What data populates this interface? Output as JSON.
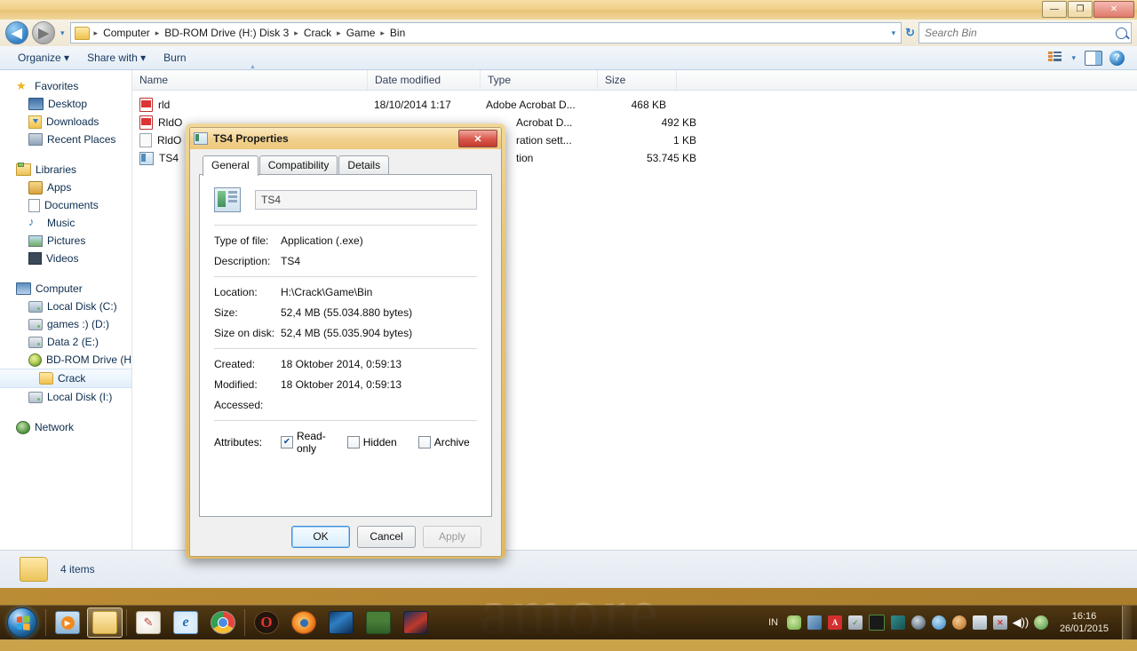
{
  "window": {
    "title": "",
    "minimize_label": "—",
    "maximize_label": "❐",
    "close_label": "✕"
  },
  "address": {
    "back_label": "◀",
    "forward_label": "▶",
    "history_caret": "▾",
    "breadcrumbs": [
      "Computer",
      "BD-ROM Drive (H:) Disk 3",
      "Crack",
      "Game",
      "Bin"
    ],
    "separator": "▸",
    "dropdown_caret": "▾",
    "refresh_label": "↻"
  },
  "search": {
    "placeholder": "Search Bin",
    "value": ""
  },
  "toolbar": {
    "items": [
      {
        "label": "Organize",
        "caret": "▾"
      },
      {
        "label": "Share with",
        "caret": "▾"
      },
      {
        "label": "Burn",
        "caret": ""
      }
    ],
    "views_caret": "▾",
    "help_label": "?"
  },
  "sidebar": {
    "groups": [
      {
        "header": {
          "label": "Favorites",
          "icon": "star-icon"
        },
        "items": [
          {
            "label": "Desktop",
            "icon": "desktop-icon"
          },
          {
            "label": "Downloads",
            "icon": "downloads-icon"
          },
          {
            "label": "Recent Places",
            "icon": "recent-places-icon"
          }
        ]
      },
      {
        "header": {
          "label": "Libraries",
          "icon": "libraries-icon"
        },
        "items": [
          {
            "label": "Apps",
            "icon": "apps-icon"
          },
          {
            "label": "Documents",
            "icon": "documents-icon"
          },
          {
            "label": "Music",
            "icon": "music-icon"
          },
          {
            "label": "Pictures",
            "icon": "pictures-icon"
          },
          {
            "label": "Videos",
            "icon": "videos-icon"
          }
        ]
      },
      {
        "header": {
          "label": "Computer",
          "icon": "computer-icon"
        },
        "items": [
          {
            "label": "Local Disk (C:)",
            "icon": "system-drive-icon"
          },
          {
            "label": "games :)  (D:)",
            "icon": "drive-icon"
          },
          {
            "label": "Data 2 (E:)",
            "icon": "drive-icon"
          },
          {
            "label": "BD-ROM Drive (H:) D",
            "icon": "optical-drive-icon"
          },
          {
            "label": "Crack",
            "icon": "folder-icon",
            "selected": true,
            "indent": true
          },
          {
            "label": "Local Disk (I:)",
            "icon": "drive-icon"
          }
        ]
      },
      {
        "header": {
          "label": "Network",
          "icon": "network-icon"
        },
        "items": []
      }
    ]
  },
  "filelist": {
    "columns": [
      {
        "label": "Name",
        "sorted": true
      },
      {
        "label": "Date modified",
        "sorted": false
      },
      {
        "label": "Type",
        "sorted": false
      },
      {
        "label": "Size",
        "sorted": false
      }
    ],
    "rows": [
      {
        "name": "rld",
        "icon": "pdf-icon",
        "date": "18/10/2014 1:17",
        "type": "Adobe Acrobat D...",
        "size": "468 KB"
      },
      {
        "name": "RldO",
        "icon": "pdf-icon",
        "date": "",
        "type": "Acrobat D...",
        "size": "492 KB"
      },
      {
        "name": "RldO",
        "icon": "config-icon",
        "date": "",
        "type": "ration sett...",
        "size": "1 KB"
      },
      {
        "name": "TS4",
        "icon": "application-icon",
        "date": "",
        "type": "tion",
        "size": "53.745 KB"
      }
    ]
  },
  "statusbar": {
    "item_count": "4 items"
  },
  "dialog": {
    "title": "TS4 Properties",
    "close_label": "✕",
    "tabs": [
      {
        "label": "General",
        "active": true
      },
      {
        "label": "Compatibility",
        "active": false
      },
      {
        "label": "Details",
        "active": false
      }
    ],
    "filename_value": "TS4",
    "properties_top": [
      {
        "key": "Type of file:",
        "value": "Application (.exe)"
      },
      {
        "key": "Description:",
        "value": "TS4"
      }
    ],
    "properties_mid": [
      {
        "key": "Location:",
        "value": "H:\\Crack\\Game\\Bin"
      },
      {
        "key": "Size:",
        "value": "52,4 MB (55.034.880 bytes)"
      },
      {
        "key": "Size on disk:",
        "value": "52,4 MB (55.035.904 bytes)"
      }
    ],
    "properties_dates": [
      {
        "key": "Created:",
        "value": "18 Oktober 2014, 0:59:13"
      },
      {
        "key": "Modified:",
        "value": "18 Oktober 2014, 0:59:13"
      },
      {
        "key": "Accessed:",
        "value": ""
      }
    ],
    "attributes_label": "Attributes:",
    "attributes": [
      {
        "label": "Read-only",
        "checked": true,
        "mark": "✔"
      },
      {
        "label": "Hidden",
        "checked": false,
        "mark": ""
      },
      {
        "label": "Archive",
        "checked": false,
        "mark": ""
      }
    ],
    "buttons": [
      {
        "label": "OK",
        "style": "default"
      },
      {
        "label": "Cancel",
        "style": "normal"
      },
      {
        "label": "Apply",
        "style": "disabled"
      }
    ]
  },
  "desktop": {
    "wallpaper_text": "amore"
  },
  "taskbar": {
    "start_label": "Start",
    "pinned": [
      {
        "name": "windows-media-player",
        "icon": "wmp-icon",
        "label": "▶",
        "active": false
      },
      {
        "name": "windows-explorer",
        "icon": "explorer-icon",
        "label": "",
        "active": true
      },
      {
        "name": "paint",
        "icon": "paint-icon",
        "label": "🎨",
        "active": false
      },
      {
        "name": "internet-explorer",
        "icon": "ie-icon",
        "label": "e",
        "active": false
      },
      {
        "name": "google-chrome",
        "icon": "chrome-icon",
        "label": "",
        "active": false
      },
      {
        "name": "opera",
        "icon": "opera-icon",
        "label": "O",
        "active": false
      },
      {
        "name": "firefox",
        "icon": "firefox-icon",
        "label": "",
        "active": false
      },
      {
        "name": "game-pes-1",
        "icon": "game-icon",
        "label": "",
        "active": false
      },
      {
        "name": "game-pes-2",
        "icon": "game-icon",
        "label": "",
        "active": false
      },
      {
        "name": "game-pes-3",
        "icon": "game-icon",
        "label": "",
        "active": false
      }
    ],
    "tray": {
      "language": "IN",
      "icons": [
        {
          "name": "android-tool-icon",
          "glyph": ""
        },
        {
          "name": "bluetooth-icon",
          "glyph": ""
        },
        {
          "name": "avira-antivirus-icon",
          "glyph": "A"
        },
        {
          "name": "usb-safely-remove-icon",
          "glyph": "✓"
        },
        {
          "name": "camera-tool-icon",
          "glyph": ""
        },
        {
          "name": "idm-icon",
          "glyph": ""
        },
        {
          "name": "nvidia-icon",
          "glyph": ""
        },
        {
          "name": "dropbox-icon",
          "glyph": ""
        },
        {
          "name": "daemon-tools-icon",
          "glyph": ""
        },
        {
          "name": "display-tool-icon",
          "glyph": ""
        },
        {
          "name": "network-disconnected-icon",
          "glyph": "✕"
        },
        {
          "name": "volume-icon",
          "glyph": "🔊"
        },
        {
          "name": "windows-update-icon",
          "glyph": ""
        }
      ],
      "time": "16:16",
      "date": "26/01/2015"
    }
  }
}
